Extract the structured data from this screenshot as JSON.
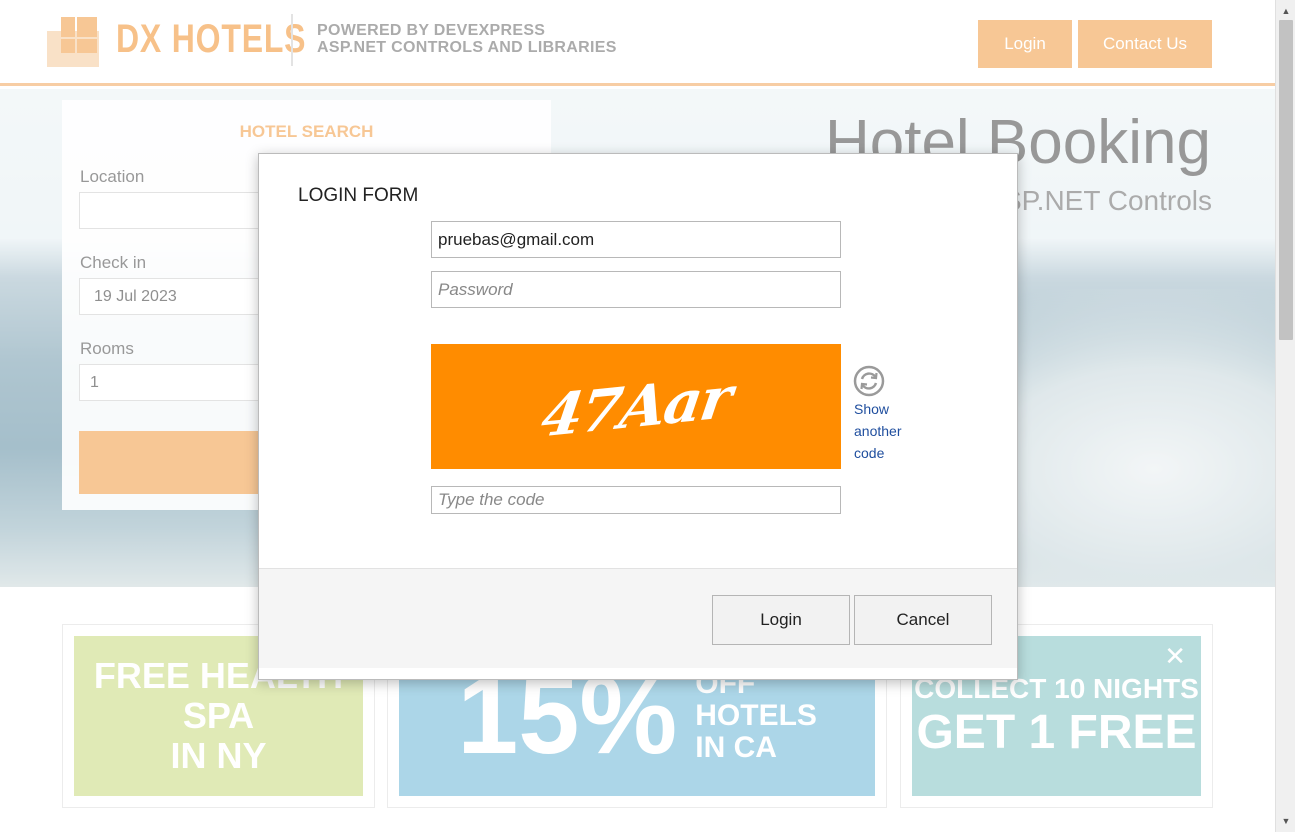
{
  "header": {
    "logo_text": "DX HOTELS",
    "powered_line1": "POWERED BY DEVEXPRESS",
    "powered_line2": "ASP.NET CONTROLS AND LIBRARIES",
    "login_label": "Login",
    "contact_label": "Contact Us",
    "accent_color": "#f19a3e"
  },
  "hero": {
    "title": "Hotel Booking",
    "subtitle": "ASP.NET Controls"
  },
  "search": {
    "title": "HOTEL SEARCH",
    "location_label": "Location",
    "location_value": "",
    "checkin_label": "Check in",
    "checkin_value": "19 Jul 2023",
    "rooms_label": "Rooms",
    "rooms_value": "1"
  },
  "promos": [
    {
      "line1": "FREE HEALTH SPA",
      "line2": "IN NY"
    },
    {
      "big": "15%",
      "line1": "OFF",
      "line2": "HOTELS",
      "line3": "IN CA"
    },
    {
      "line1": "COLLECT 10 NIGHTS",
      "line2": "GET 1 FREE",
      "close": "✕"
    }
  ],
  "login_form": {
    "title": "LOGIN FORM",
    "email_value": "pruebas@gmail.com",
    "password_placeholder": "Password",
    "captcha_text": "47Aar",
    "refresh_icon": "refresh-icon",
    "refresh_line1": "Show",
    "refresh_line2": "another",
    "refresh_line3": "code",
    "code_placeholder": "Type the code",
    "login_button": "Login",
    "cancel_button": "Cancel"
  },
  "scrollbar": {
    "up_icon": "▲",
    "down_icon": "▼"
  }
}
